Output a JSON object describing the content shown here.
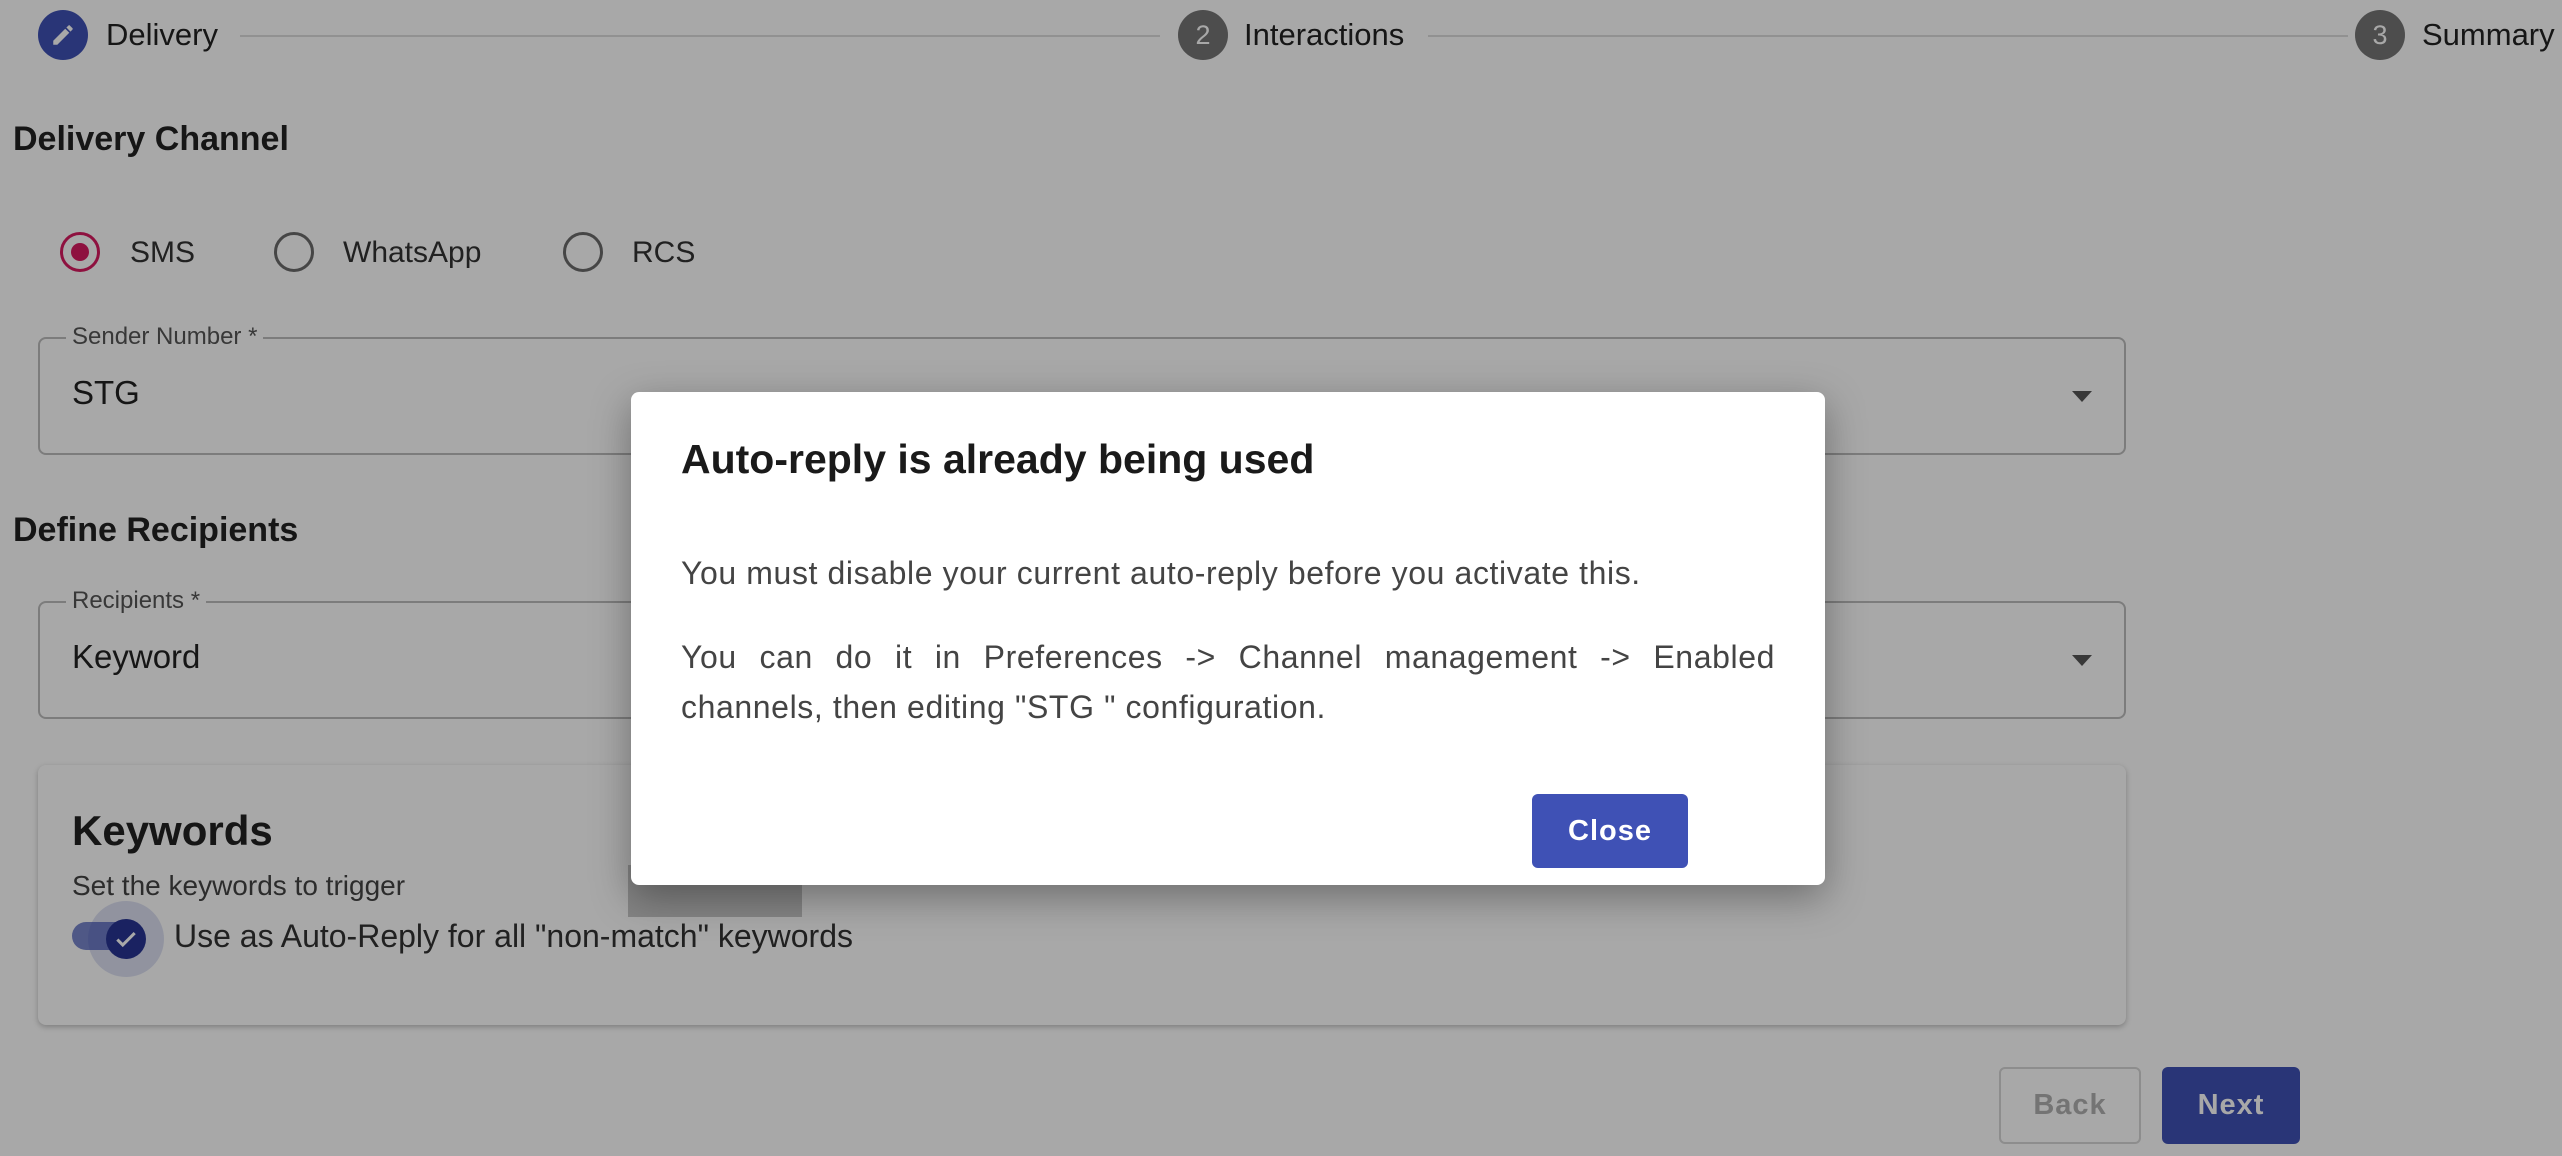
{
  "stepper": {
    "steps": [
      {
        "number": "",
        "label": "Delivery",
        "icon": "pencil-icon",
        "color": "#3f51b5"
      },
      {
        "number": "2",
        "label": "Interactions",
        "color": "#757575"
      },
      {
        "number": "3",
        "label": "Summary",
        "color": "#757575"
      }
    ]
  },
  "delivery_channel": {
    "title": "Delivery Channel",
    "options": [
      "SMS",
      "WhatsApp",
      "RCS"
    ],
    "selected": "SMS"
  },
  "sender_number": {
    "label": "Sender Number *",
    "value": "STG"
  },
  "define_recipients": {
    "title": "Define Recipients",
    "recipients": {
      "label": "Recipients *",
      "value": "Keyword"
    }
  },
  "keywords": {
    "title": "Keywords",
    "subtitle": "Set the keywords to trigger",
    "toggle_label": "Use as Auto-Reply for all \"non-match\" keywords",
    "toggle_on": true
  },
  "footer": {
    "back_label": "Back",
    "next_label": "Next"
  },
  "dialog": {
    "title": "Auto-reply is already being used",
    "paragraph1": "You must disable your current auto-reply before you activate this.",
    "paragraph2": "You can do it in Preferences -> Channel management -> Enabled channels, then editing \"STG             \" configuration.",
    "close_label": "Close"
  },
  "colors": {
    "primary": "#3f51b5",
    "radio_accent": "#d81b60"
  }
}
